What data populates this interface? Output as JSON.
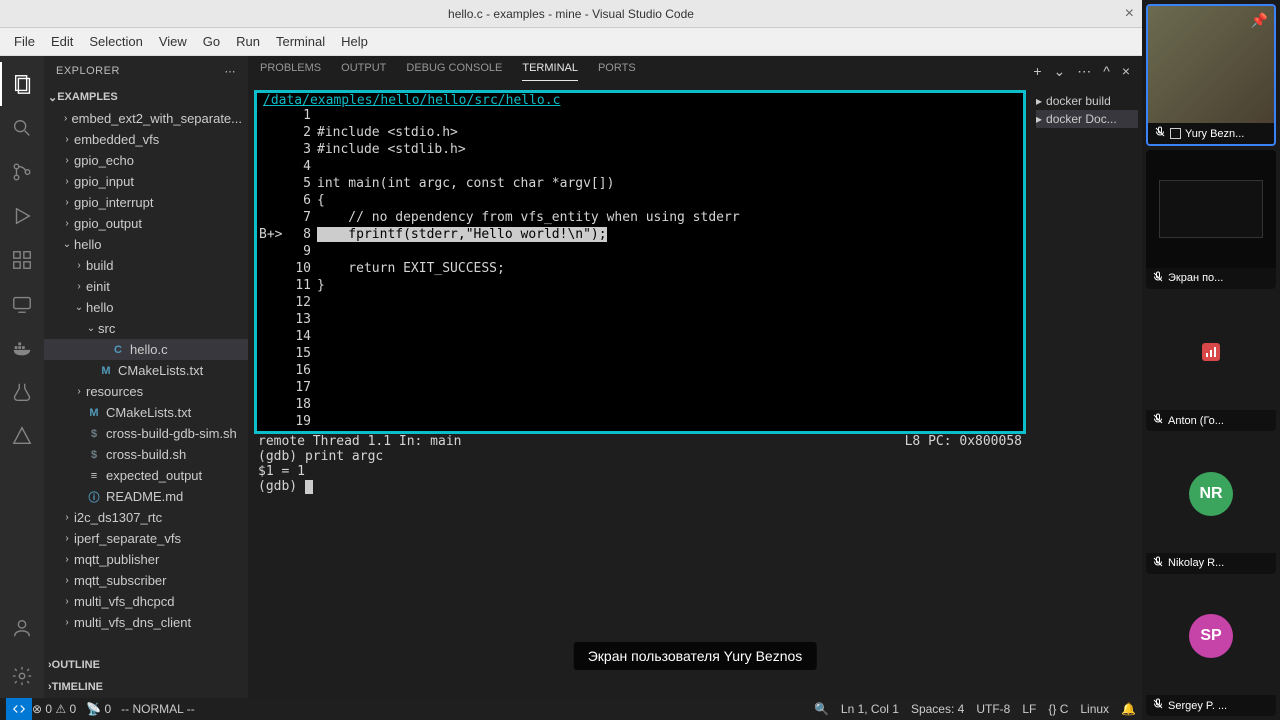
{
  "titlebar": {
    "title": "hello.c - examples - mine - Visual Studio Code"
  },
  "menu": {
    "items": [
      "File",
      "Edit",
      "Selection",
      "View",
      "Go",
      "Run",
      "Terminal",
      "Help"
    ]
  },
  "sidebar": {
    "title": "EXPLORER",
    "root": "EXAMPLES",
    "outline": "OUTLINE",
    "timeline": "TIMELINE",
    "tree": [
      {
        "label": "embed_ext2_with_separate...",
        "indent": 1,
        "chev": "›"
      },
      {
        "label": "embedded_vfs",
        "indent": 1,
        "chev": "›"
      },
      {
        "label": "gpio_echo",
        "indent": 1,
        "chev": "›"
      },
      {
        "label": "gpio_input",
        "indent": 1,
        "chev": "›"
      },
      {
        "label": "gpio_interrupt",
        "indent": 1,
        "chev": "›"
      },
      {
        "label": "gpio_output",
        "indent": 1,
        "chev": "›"
      },
      {
        "label": "hello",
        "indent": 1,
        "chev": "⌄"
      },
      {
        "label": "build",
        "indent": 2,
        "chev": "›"
      },
      {
        "label": "einit",
        "indent": 2,
        "chev": "›"
      },
      {
        "label": "hello",
        "indent": 2,
        "chev": "⌄"
      },
      {
        "label": "src",
        "indent": 3,
        "chev": "⌄"
      },
      {
        "label": "hello.c",
        "indent": 4,
        "icon": "C",
        "iconcls": "c",
        "selected": true
      },
      {
        "label": "CMakeLists.txt",
        "indent": 3,
        "icon": "M",
        "iconcls": "m"
      },
      {
        "label": "resources",
        "indent": 2,
        "chev": "›"
      },
      {
        "label": "CMakeLists.txt",
        "indent": 2,
        "icon": "M",
        "iconcls": "m"
      },
      {
        "label": "cross-build-gdb-sim.sh",
        "indent": 2,
        "icon": "$",
        "iconcls": "sh"
      },
      {
        "label": "cross-build.sh",
        "indent": 2,
        "icon": "$",
        "iconcls": "sh"
      },
      {
        "label": "expected_output",
        "indent": 2,
        "icon": "≡",
        "iconcls": "txt"
      },
      {
        "label": "README.md",
        "indent": 2,
        "icon": "ⓘ",
        "iconcls": "info"
      },
      {
        "label": "i2c_ds1307_rtc",
        "indent": 1,
        "chev": "›"
      },
      {
        "label": "iperf_separate_vfs",
        "indent": 1,
        "chev": "›"
      },
      {
        "label": "mqtt_publisher",
        "indent": 1,
        "chev": "›"
      },
      {
        "label": "mqtt_subscriber",
        "indent": 1,
        "chev": "›"
      },
      {
        "label": "multi_vfs_dhcpcd",
        "indent": 1,
        "chev": "›"
      },
      {
        "label": "multi_vfs_dns_client",
        "indent": 1,
        "chev": "›"
      }
    ]
  },
  "panel": {
    "tabs": [
      "PROBLEMS",
      "OUTPUT",
      "DEBUG CONSOLE",
      "TERMINAL",
      "PORTS"
    ],
    "active_tab": "TERMINAL",
    "terminals": [
      {
        "label": "docker build"
      },
      {
        "label": "docker Doc..."
      }
    ]
  },
  "code": {
    "path": "/data/examples/hello/hello/src/hello.c",
    "bp_mark": "B+>",
    "lines": [
      {
        "n": 1,
        "t": ""
      },
      {
        "n": 2,
        "t": "#include <stdio.h>"
      },
      {
        "n": 3,
        "t": "#include <stdlib.h>"
      },
      {
        "n": 4,
        "t": ""
      },
      {
        "n": 5,
        "t": "int main(int argc, const char *argv[])"
      },
      {
        "n": 6,
        "t": "{"
      },
      {
        "n": 7,
        "t": "    // no dependency from vfs_entity when using stderr"
      },
      {
        "n": 8,
        "t": "    fprintf(stderr,\"Hello world!\\n\");",
        "hl": true
      },
      {
        "n": 9,
        "t": ""
      },
      {
        "n": 10,
        "t": "    return EXIT_SUCCESS;"
      },
      {
        "n": 11,
        "t": "}"
      },
      {
        "n": 12,
        "t": ""
      },
      {
        "n": 13,
        "t": ""
      },
      {
        "n": 14,
        "t": ""
      },
      {
        "n": 15,
        "t": ""
      },
      {
        "n": 16,
        "t": ""
      },
      {
        "n": 17,
        "t": ""
      },
      {
        "n": 18,
        "t": ""
      },
      {
        "n": 19,
        "t": ""
      }
    ],
    "status_left": "remote Thread 1.1 In: main",
    "status_right": "L8    PC: 0x800058",
    "gdb": [
      "(gdb) print argc",
      "$1 = 1",
      "(gdb) "
    ]
  },
  "statusbar": {
    "errors": "0",
    "warnings": "0",
    "ports": "0",
    "mode": "-- NORMAL --",
    "lncol": "Ln 1, Col 1",
    "spaces": "Spaces: 4",
    "enc": "UTF-8",
    "eol": "LF",
    "lang": "{} C",
    "os": "Linux"
  },
  "caption": "Экран пользователя Yury Beznos",
  "meeting": {
    "participants": [
      {
        "name": "Yury Bezn...",
        "type": "cam",
        "active": true,
        "pinned": true
      },
      {
        "name": "Экран по...",
        "type": "screen"
      },
      {
        "name": "Anton (Го...",
        "type": "stats"
      },
      {
        "name": "Nikolay R...",
        "type": "avatar",
        "initials": "NR",
        "color": "#3ba55d"
      },
      {
        "name": "Sergey P. ...",
        "type": "avatar",
        "initials": "SP",
        "color": "#c644a8"
      }
    ]
  }
}
